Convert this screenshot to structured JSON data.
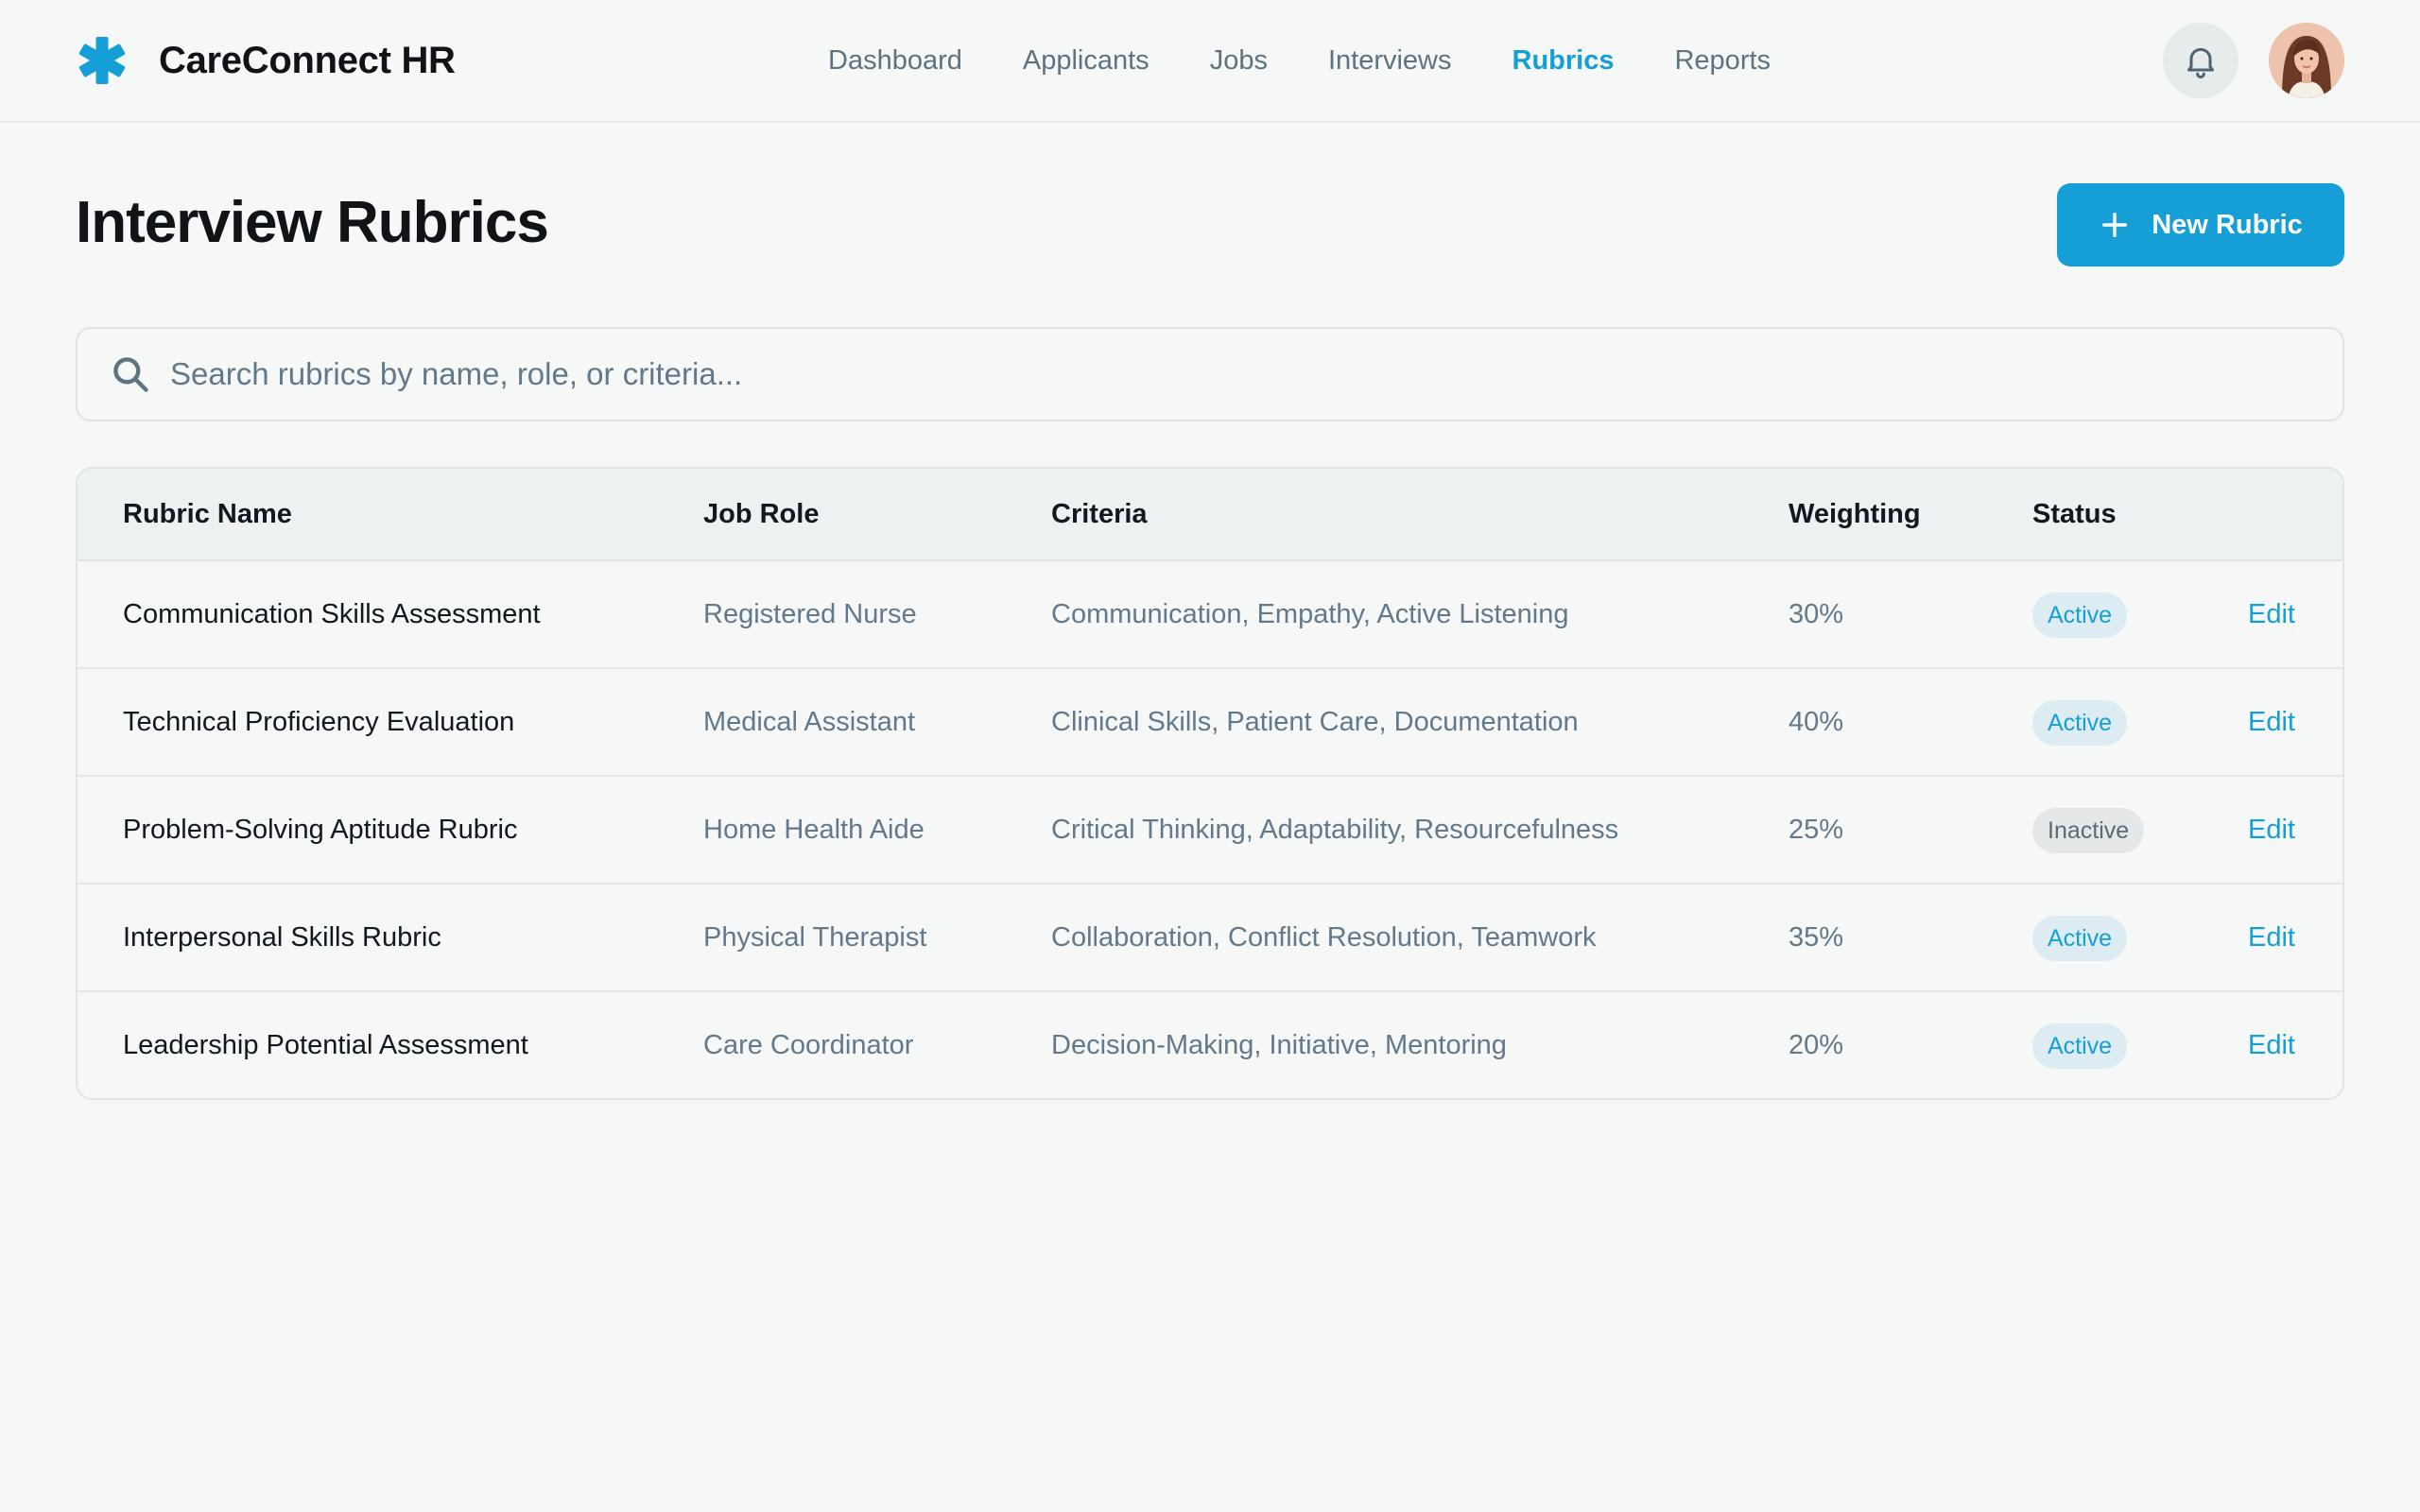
{
  "app": {
    "name": "CareConnect HR",
    "logo_icon": "medical-asterisk-icon",
    "accent_color": "#169fd6"
  },
  "nav": {
    "items": [
      {
        "label": "Dashboard",
        "active": false
      },
      {
        "label": "Applicants",
        "active": false
      },
      {
        "label": "Jobs",
        "active": false
      },
      {
        "label": "Interviews",
        "active": false
      },
      {
        "label": "Rubrics",
        "active": true
      },
      {
        "label": "Reports",
        "active": false
      }
    ]
  },
  "header_actions": {
    "notifications_icon": "bell-icon",
    "avatar": "user-avatar"
  },
  "page": {
    "title": "Interview Rubrics",
    "new_button_label": "New Rubric",
    "new_button_icon": "plus-icon"
  },
  "search": {
    "placeholder": "Search rubrics by name, role, or criteria...",
    "value": ""
  },
  "table": {
    "columns": [
      "Rubric Name",
      "Job Role",
      "Criteria",
      "Weighting",
      "Status"
    ],
    "rows": [
      {
        "name": "Communication Skills Assessment",
        "role": "Registered Nurse",
        "criteria": "Communication, Empathy, Active Listening",
        "weighting": "30%",
        "status": "Active",
        "action": "Edit"
      },
      {
        "name": "Technical Proficiency Evaluation",
        "role": "Medical Assistant",
        "criteria": "Clinical Skills, Patient Care, Documentation",
        "weighting": "40%",
        "status": "Active",
        "action": "Edit"
      },
      {
        "name": "Problem-Solving Aptitude Rubric",
        "role": "Home Health Aide",
        "criteria": "Critical Thinking, Adaptability, Resourcefulness",
        "weighting": "25%",
        "status": "Inactive",
        "action": "Edit"
      },
      {
        "name": "Interpersonal Skills Rubric",
        "role": "Physical Therapist",
        "criteria": "Collaboration, Conflict Resolution, Teamwork",
        "weighting": "35%",
        "status": "Active",
        "action": "Edit"
      },
      {
        "name": "Leadership Potential Assessment",
        "role": "Care Coordinator",
        "criteria": "Decision-Making, Initiative, Mentoring",
        "weighting": "20%",
        "status": "Active",
        "action": "Edit"
      }
    ]
  }
}
